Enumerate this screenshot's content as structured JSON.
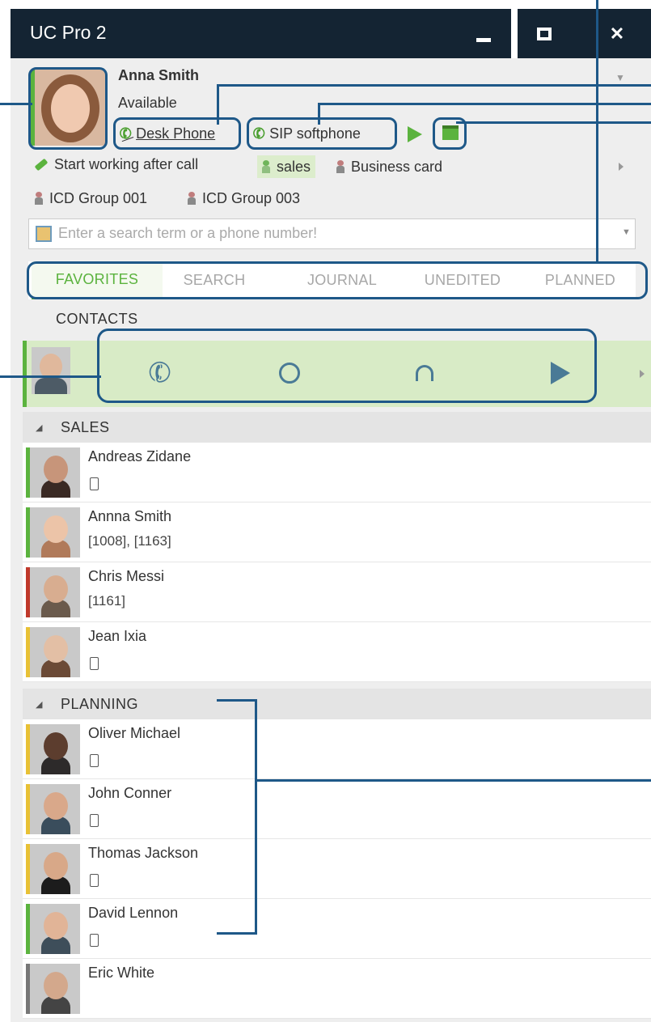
{
  "window": {
    "title": "UC Pro 2"
  },
  "profile": {
    "name": "Anna Smith",
    "status": "Available",
    "devices": [
      "Desk Phone",
      "SIP softphone"
    ]
  },
  "quick_actions": {
    "start_working": "Start working after call",
    "chips": [
      "sales",
      "Business card",
      "ICD Group 001",
      "ICD Group 003"
    ]
  },
  "search": {
    "placeholder": "Enter a search term or a phone number!"
  },
  "tabs": [
    {
      "label": "FAVORITES",
      "active": true
    },
    {
      "label": "SEARCH",
      "active": false
    },
    {
      "label": "JOURNAL",
      "active": false
    },
    {
      "label": "UNEDITED",
      "active": false
    },
    {
      "label": "PLANNED",
      "active": false
    }
  ],
  "contacts_header": "CONTACTS",
  "selected_contact": {
    "actions": [
      "call-icon",
      "chat-icon",
      "headset-icon",
      "play-icon"
    ]
  },
  "groups": [
    {
      "name": "SALES",
      "contacts": [
        {
          "name": "Andreas Zidane",
          "detail": "",
          "has_mobile": true,
          "status_color": "#5bb33e"
        },
        {
          "name": "Annna Smith",
          "detail": "[1008], [1163]",
          "has_mobile": false,
          "status_color": "#5bb33e"
        },
        {
          "name": "Chris Messi",
          "detail": "[1161]",
          "has_mobile": false,
          "status_color": "#c0392b"
        },
        {
          "name": "Jean Ixia",
          "detail": "",
          "has_mobile": true,
          "status_color": "#e8c135"
        }
      ]
    },
    {
      "name": "PLANNING",
      "contacts": [
        {
          "name": "Oliver Michael",
          "detail": "",
          "has_mobile": true,
          "status_color": "#e8c135"
        },
        {
          "name": "John Conner",
          "detail": "",
          "has_mobile": true,
          "status_color": "#e8c135"
        },
        {
          "name": "Thomas Jackson",
          "detail": "",
          "has_mobile": true,
          "status_color": "#e8c135"
        },
        {
          "name": "David Lennon",
          "detail": "",
          "has_mobile": true,
          "status_color": "#5bb33e"
        },
        {
          "name": "Eric White",
          "detail": "",
          "has_mobile": false,
          "status_color": "#777777"
        }
      ]
    }
  ],
  "colors": {
    "titlebar": "#142433",
    "accent": "#5bb33e",
    "selected_row": "#d8ebc6",
    "callout": "#1e5888"
  }
}
